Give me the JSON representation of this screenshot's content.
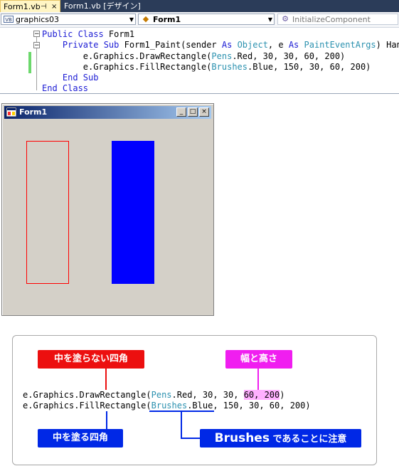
{
  "editor": {
    "tabs": [
      {
        "label": "Form1.vb",
        "pin": "⊣",
        "close": "×"
      },
      {
        "label": "Form1.vb [デザイン]"
      }
    ],
    "dropdowns": {
      "project": "graphics03",
      "class": "Form1",
      "member": "InitializeComponent"
    },
    "code": {
      "line1": {
        "kw1": "Public Class",
        "name": " Form1"
      },
      "line2": {
        "indent": "    ",
        "kw1": "Private Sub",
        "name": " Form1_Paint(sender ",
        "kw2": "As",
        "t1": " Object",
        "mid": ", e ",
        "kw3": "As",
        "t2": " PaintEventArgs",
        "rest": ") Han"
      },
      "line3": {
        "indent": "        ",
        "pre": "e.Graphics.DrawRectangle(",
        "type": "Pens",
        "post": ".Red, 30, 30, 60, 200)"
      },
      "line4": {
        "indent": "        ",
        "pre": "e.Graphics.FillRectangle(",
        "type": "Brushes",
        "post": ".Blue, 150, 30, 60, 200)"
      },
      "line5": {
        "indent": "    ",
        "kw": "End Sub"
      },
      "line6": {
        "kw": "End Class"
      }
    }
  },
  "form_window": {
    "title": "Form1",
    "controls": {
      "minimize": "_",
      "maximize": "□",
      "close": "×"
    },
    "colors": {
      "drawn_rect": "#ff0000",
      "filled_rect": "#0000ff",
      "background": "#d4d0c8"
    }
  },
  "annotation": {
    "label_draw": "中を塗らない四角",
    "label_size": "幅と高さ",
    "label_fill": "中を塗る四角",
    "label_brushes_main": "Brushes",
    "label_brushes_rest": " であることに注意",
    "line1": {
      "pre": "e.Graphics.DrawRectangle(",
      "type": "Pens",
      "mid": ".Red, 30, 30, ",
      "hl": "60, 200",
      "post": ")"
    },
    "line2": {
      "pre": "e.Graphics.FillRectangle(",
      "type": "Brushes",
      "post": ".Blue, 150, 30, 60, 200)"
    }
  }
}
